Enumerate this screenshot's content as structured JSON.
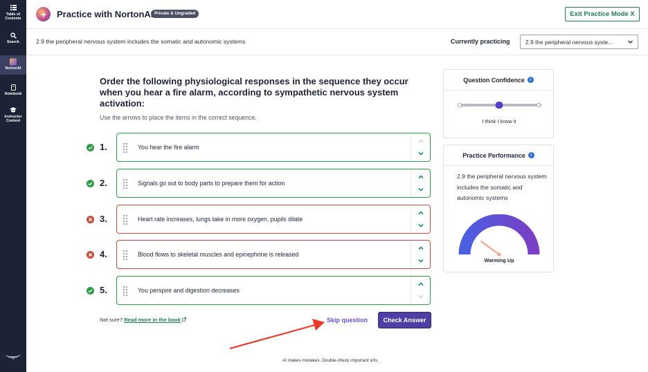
{
  "sidebar": {
    "items": [
      {
        "label_line1": "Table of",
        "label_line2": "Contents",
        "icon": "toc-icon"
      },
      {
        "label_line1": "Search",
        "label_line2": "",
        "icon": "search-icon"
      },
      {
        "label_line1": "NortonAI",
        "label_line2": "",
        "icon": "nortonai-icon"
      },
      {
        "label_line1": "Notebook",
        "label_line2": "",
        "icon": "notebook-icon"
      },
      {
        "label_line1": "Instructor",
        "label_line2": "Content",
        "icon": "graduation-cap-icon"
      }
    ]
  },
  "header": {
    "title": "Practice with NortonAI",
    "badge": "Private & Ungraded",
    "exit_label": "Exit Practice Mode X"
  },
  "subheader": {
    "section": "2.9 the peripheral nervous system includes the somatic and autonomic systems",
    "currently_practicing_label": "Currently practicing",
    "select_value": "2.9 the peripheral nervous syste..."
  },
  "question": {
    "prompt": "Order the following physiological responses in the sequence they occur when you hear a fire alarm, according to sympathetic nervous system activation:",
    "instructions": "Use the arrows to place the items in the correct sequence.",
    "items": [
      {
        "number": "1.",
        "text": "You hear the fire alarm",
        "status": "correct"
      },
      {
        "number": "2.",
        "text": "Signals go out to body parts to prepare them for action",
        "status": "correct"
      },
      {
        "number": "3.",
        "text": "Heart rate increases, lungs take in more oxygen, pupils dilate",
        "status": "incorrect"
      },
      {
        "number": "4.",
        "text": "Blood flows to skeletal muscles and epinephrine is released",
        "status": "incorrect"
      },
      {
        "number": "5.",
        "text": "You perspire and digestion decreases",
        "status": "correct"
      }
    ],
    "not_sure": "Not sure?",
    "read_more": "Read more in the book",
    "skip_label": "Skip question",
    "check_label": "Check Answer",
    "disclaimer": "AI makes mistakes. Double-check important info."
  },
  "confidence": {
    "title": "Question Confidence",
    "value_label": "I think I know it",
    "level": 0.5
  },
  "performance": {
    "title": "Practice Performance",
    "text": "2.9 the peripheral nervous system includes the somatic and autonomic systems",
    "gauge_label": "Warming Up",
    "gauge_level": 0.2
  },
  "colors": {
    "sidebar": "#1d2236",
    "correct": "#2e9a45",
    "incorrect": "#c94a3c",
    "accent": "#4f3fa4",
    "exit_green": "#1e7b57"
  }
}
